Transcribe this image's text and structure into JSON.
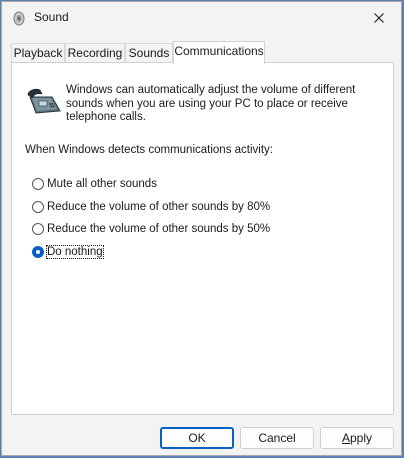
{
  "window": {
    "title": "Sound"
  },
  "tabs": [
    {
      "label": "Playback",
      "active": false
    },
    {
      "label": "Recording",
      "active": false
    },
    {
      "label": "Sounds",
      "active": false
    },
    {
      "label": "Communications",
      "active": true
    }
  ],
  "communications": {
    "description": "Windows can automatically adjust the volume of different sounds when you are using your PC to place or receive telephone calls.",
    "prompt": "When Windows detects communications activity:",
    "options": [
      {
        "label": "Mute all other sounds",
        "checked": false
      },
      {
        "label": "Reduce the volume of other sounds by 80%",
        "checked": false
      },
      {
        "label": "Reduce the volume of other sounds by 50%",
        "checked": false
      },
      {
        "label": "Do nothing",
        "checked": true
      }
    ]
  },
  "buttons": {
    "ok": "OK",
    "cancel": "Cancel",
    "apply_first": "A",
    "apply_rest": "pply"
  },
  "colors": {
    "accent": "#0a5fc4",
    "window_bg": "#f3f3f3",
    "panel_bg": "#ffffff"
  }
}
